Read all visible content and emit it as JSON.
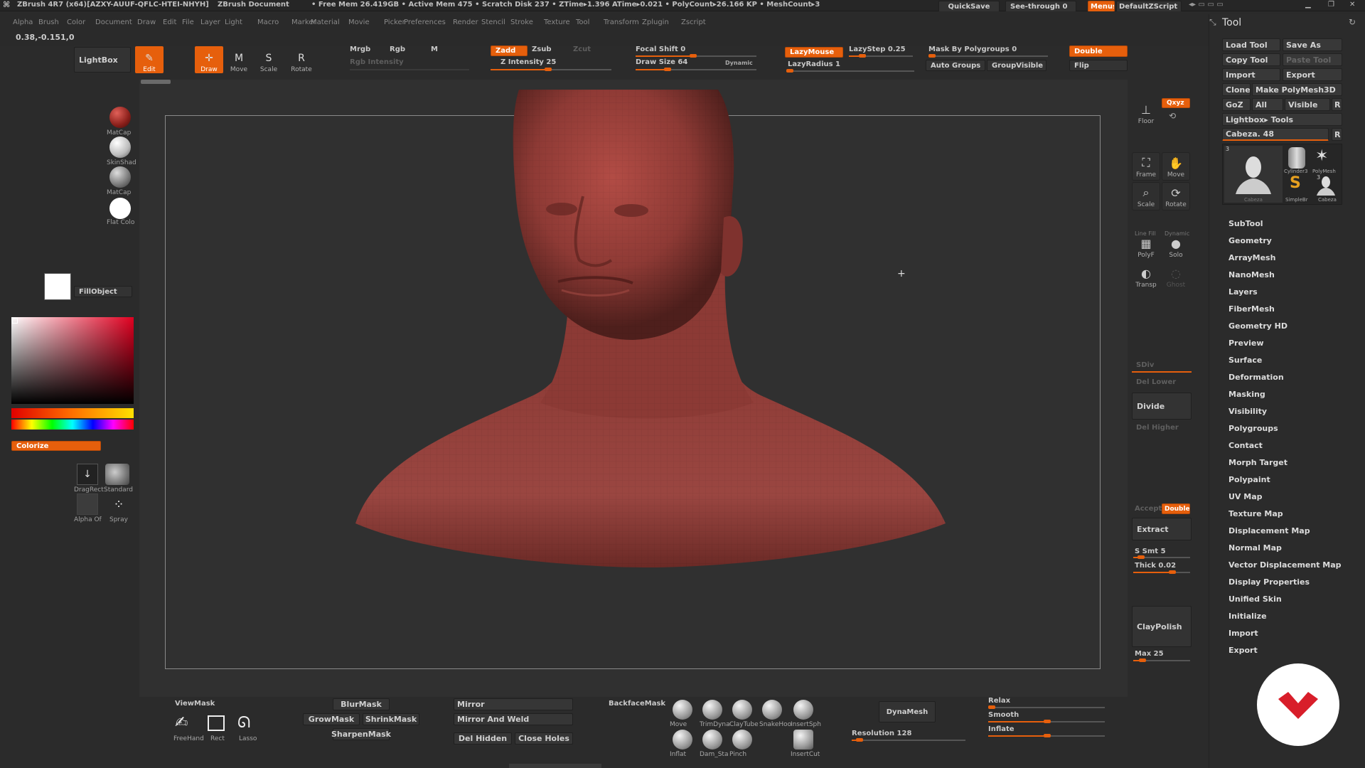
{
  "titlebar": {
    "app": "ZBrush 4R7 (x64)[AZXY-AUUF-QFLC-HTEI-NHYH]",
    "doc": "ZBrush Document",
    "stats": "• Free Mem 26.419GB • Active Mem 475 • Scratch Disk 237 • ZTime▸1.396 ATime▸0.021 • PolyCount▸26.166 KP • MeshCount▸3",
    "quicksave": "QuickSave",
    "seethrough": "See-through  0",
    "menus": "Menus",
    "script": "DefaultZScript"
  },
  "menus": [
    "Alpha",
    "Brush",
    "Color",
    "Document",
    "Draw",
    "Edit",
    "File",
    "Layer",
    "Light",
    "Macro",
    "Marker",
    "Material",
    "Movie",
    "Picker",
    "Preferences",
    "Render",
    "Stencil",
    "Stroke",
    "Texture",
    "Tool",
    "Transform",
    "Zplugin",
    "Zscript"
  ],
  "coords": "0.38,-0.151,0",
  "shelf": {
    "lightbox": "LightBox",
    "edit": "Edit",
    "draw": "Draw",
    "move": "Move",
    "scale": "Scale",
    "rotate": "Rotate",
    "mrgb": "Mrgb",
    "rgb": "Rgb",
    "m": "M",
    "rgb_intensity": "Rgb  Intensity",
    "zadd": "Zadd",
    "zsub": "Zsub",
    "zcut": "Zcut",
    "z_intensity": "Z Intensity 25",
    "focal_shift": "Focal Shift 0",
    "draw_size": "Draw Size 64",
    "dynamic": "Dynamic",
    "lazymouse": "LazyMouse",
    "lazystep": "LazyStep 0.25",
    "lazyradius": "LazyRadius 1",
    "mask_polygroups": "Mask By Polygroups 0",
    "auto_groups": "Auto Groups",
    "groupvisible": "GroupVisible",
    "double": "Double",
    "flip": "Flip"
  },
  "left": {
    "matcap1": "MatCap",
    "skinshade": "SkinShad",
    "matcap2": "MatCap",
    "flatcolor": "Flat Colo",
    "fillobject": "FillObject",
    "colorize": "Colorize",
    "dragrect": "DragRect",
    "standard": "Standard",
    "alpha": "Alpha  Of",
    "spray": "Spray"
  },
  "rightstrip": {
    "floor": "Floor",
    "xyz": "Qxyz",
    "frame": "Frame",
    "move": "Move",
    "scale": "Scale",
    "rotate": "Rotate",
    "linefill": "Line Fill",
    "polyf": "PolyF",
    "dynamic": "Dynamic",
    "solo": "Solo",
    "transp": "Transp",
    "ghost": "Ghost",
    "sdiv": "SDiv",
    "del_lower": "Del Lower",
    "divide": "Divide",
    "del_higher": "Del Higher",
    "accept": "Accept",
    "double": "Double",
    "extract": "Extract",
    "s_smt": "S Smt 5",
    "thick": "Thick 0.02",
    "claypolish": "ClayPolish",
    "max": "Max 25"
  },
  "tool": {
    "title": "Tool",
    "load": "Load Tool",
    "saveas": "Save As",
    "copy": "Copy Tool",
    "paste": "Paste Tool",
    "import": "Import",
    "export": "Export",
    "clone": "Clone",
    "makepoly": "Make PolyMesh3D",
    "goz": "GoZ",
    "all": "All",
    "visible": "Visible",
    "r": "R",
    "lightbox_tools": "Lightbox▸ Tools",
    "cabeza": "Cabeza. 48",
    "thumbs": [
      "Cabeza",
      "Cylinder3",
      "PolyMesh",
      "SimpleBr",
      "Cabeza"
    ],
    "thumb_counts": [
      "3",
      "3"
    ],
    "entries": [
      "SubTool",
      "Geometry",
      "ArrayMesh",
      "NanoMesh",
      "Layers",
      "FiberMesh",
      "Geometry HD",
      "Preview",
      "Surface",
      "Deformation",
      "Masking",
      "Visibility",
      "Polygroups",
      "Contact",
      "Morph Target",
      "Polypaint",
      "UV Map",
      "Texture Map",
      "Displacement Map",
      "Normal Map",
      "Vector Displacement Map",
      "Display Properties",
      "Unified Skin",
      "Initialize",
      "Import",
      "Export"
    ]
  },
  "bottom": {
    "viewmask": "ViewMask",
    "freehand": "FreeHand",
    "rect": "Rect",
    "lasso": "Lasso",
    "blurmask": "BlurMask",
    "growmask": "GrowMask",
    "shrinkmask": "ShrinkMask",
    "sharpenmask": "SharpenMask",
    "mirror": "Mirror",
    "mirror_weld": "Mirror And Weld",
    "del_hidden": "Del Hidden",
    "close_holes": "Close Holes",
    "backfacemask": "BackfaceMask",
    "brushes": [
      "Move",
      "TrimDyna",
      "ClayTube",
      "SnakeHoo",
      "InsertSph",
      "Inflat",
      "Dam_Sta",
      "Pinch",
      "InsertCut"
    ],
    "dynamesh": "DynaMesh",
    "resolution": "Resolution 128",
    "relax": "Relax",
    "smooth": "Smooth",
    "inflate": "Inflate"
  },
  "colors": {
    "accent": "#e65f0c",
    "clay": "#8e3a35",
    "panel": "#2b2b2b"
  }
}
